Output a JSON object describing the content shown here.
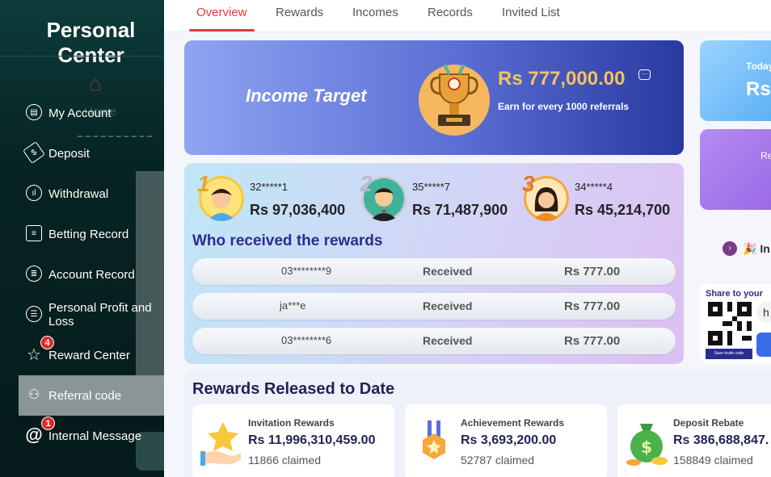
{
  "sidebar": {
    "title_line1": "Personal",
    "title_line2": "Center",
    "items": [
      {
        "label": "My Account",
        "icon": "account-icon"
      },
      {
        "label": "Deposit",
        "icon": "deposit-icon"
      },
      {
        "label": "Withdrawal",
        "icon": "withdrawal-icon"
      },
      {
        "label": "Betting Record",
        "icon": "betting-record-icon"
      },
      {
        "label": "Account Record",
        "icon": "account-record-icon"
      },
      {
        "label": "Personal Profit and Loss",
        "icon": "profit-loss-icon"
      },
      {
        "label": "Reward Center",
        "icon": "reward-icon",
        "badge": "4"
      },
      {
        "label": "Referral code",
        "icon": "referral-icon",
        "active": true
      },
      {
        "label": "Internal Message",
        "icon": "at-icon",
        "badge": "1"
      }
    ],
    "background_ghost": "Home"
  },
  "tabs": [
    "Overview",
    "Rewards",
    "Incomes",
    "Records",
    "Invited List"
  ],
  "active_tab": "Overview",
  "income_target": {
    "label": "Income Target",
    "amount": "Rs  777,000.00",
    "subtitle": "Earn for every 1000 referrals"
  },
  "leaders": [
    {
      "rank": "1",
      "user": "32*****1",
      "amount": "Rs 97,036,400"
    },
    {
      "rank": "2",
      "user": "35*****7",
      "amount": "Rs 71,487,900"
    },
    {
      "rank": "3",
      "user": "34*****4",
      "amount": "Rs 45,214,700"
    }
  ],
  "who_received": {
    "heading": "Who received the rewards",
    "rows": [
      {
        "user": "03********9",
        "status": "Received",
        "amount": "Rs  777.00"
      },
      {
        "user": "ja***e",
        "status": "Received",
        "amount": "Rs  777.00"
      },
      {
        "user": "03********6",
        "status": "Received",
        "amount": "Rs  777.00"
      }
    ]
  },
  "rewards_released": {
    "heading": "Rewards Released to Date",
    "cards": [
      {
        "title": "Invitation Rewards",
        "value": "Rs  11,996,310,459.00",
        "claimed": "11866 claimed"
      },
      {
        "title": "Achievement Rewards",
        "value": "Rs  3,693,200.00",
        "claimed": "52787 claimed"
      },
      {
        "title": "Deposit Rebate",
        "value": "Rs  386,688,847.",
        "claimed": "158849 claimed"
      }
    ]
  },
  "right_panel": {
    "today": "Today",
    "rs": "Rs",
    "re": "Re",
    "invite": "In",
    "share": "Share to your",
    "save": "Save invite code",
    "pill_text": "h"
  },
  "colors": {
    "accent": "#e43b3b",
    "navy": "#2b2d8f",
    "sidebar": "#072323"
  }
}
